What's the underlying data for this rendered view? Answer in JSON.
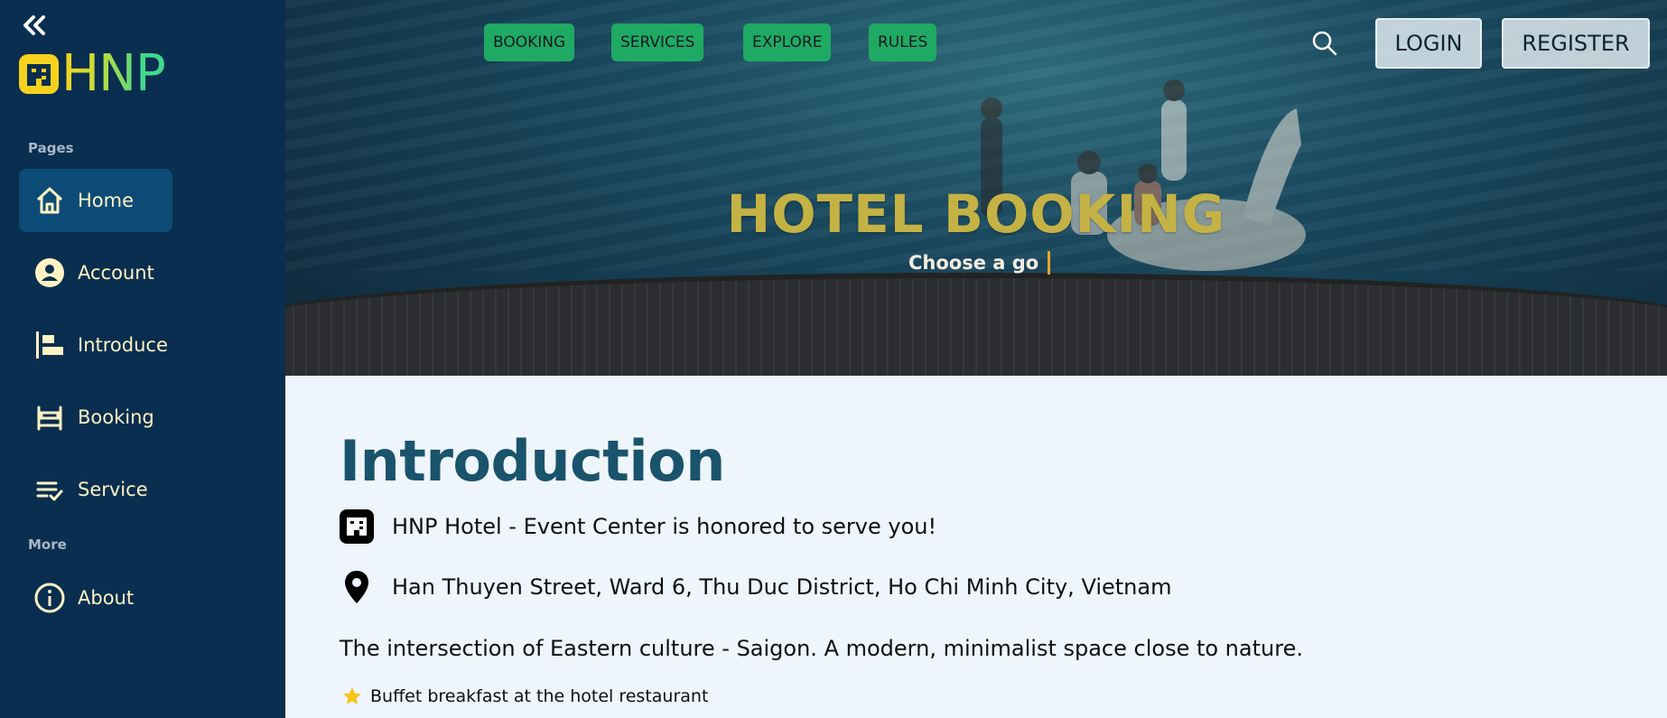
{
  "sidebar": {
    "logo_text": "HNP",
    "sections": {
      "pages": "Pages",
      "more": "More"
    },
    "items": [
      {
        "label": "Home",
        "icon": "home-icon"
      },
      {
        "label": "Account",
        "icon": "account-icon"
      },
      {
        "label": "Introduce",
        "icon": "introduce-icon"
      },
      {
        "label": "Booking",
        "icon": "bed-icon"
      },
      {
        "label": "Service",
        "icon": "checklist-icon"
      },
      {
        "label": "About",
        "icon": "info-icon"
      }
    ]
  },
  "topnav": {
    "links": [
      "BOOKING",
      "SERVICES",
      "EXPLORE",
      "RULES"
    ],
    "login": "LOGIN",
    "register": "REGISTER"
  },
  "hero": {
    "title": "HOTEL BOOKING",
    "subtitle": "Choose a go"
  },
  "content": {
    "title": "Introduction",
    "tagline": "HNP Hotel - Event Center is honored to serve you!",
    "address": "Han Thuyen Street, Ward 6, Thu Duc District, Ho Chi Minh City, Vietnam",
    "description": "The intersection of Eastern culture - Saigon. A modern, minimalist space close to nature.",
    "features": [
      "Buffet breakfast at the hotel restaurant"
    ]
  },
  "colors": {
    "sidebar_bg": "#0a2e4f",
    "active_item": "#0d4b77",
    "nav_button": "#1faa63",
    "title_gold": "#c5b245",
    "intro_title": "#1a536c",
    "content_bg": "#eef5fd"
  }
}
